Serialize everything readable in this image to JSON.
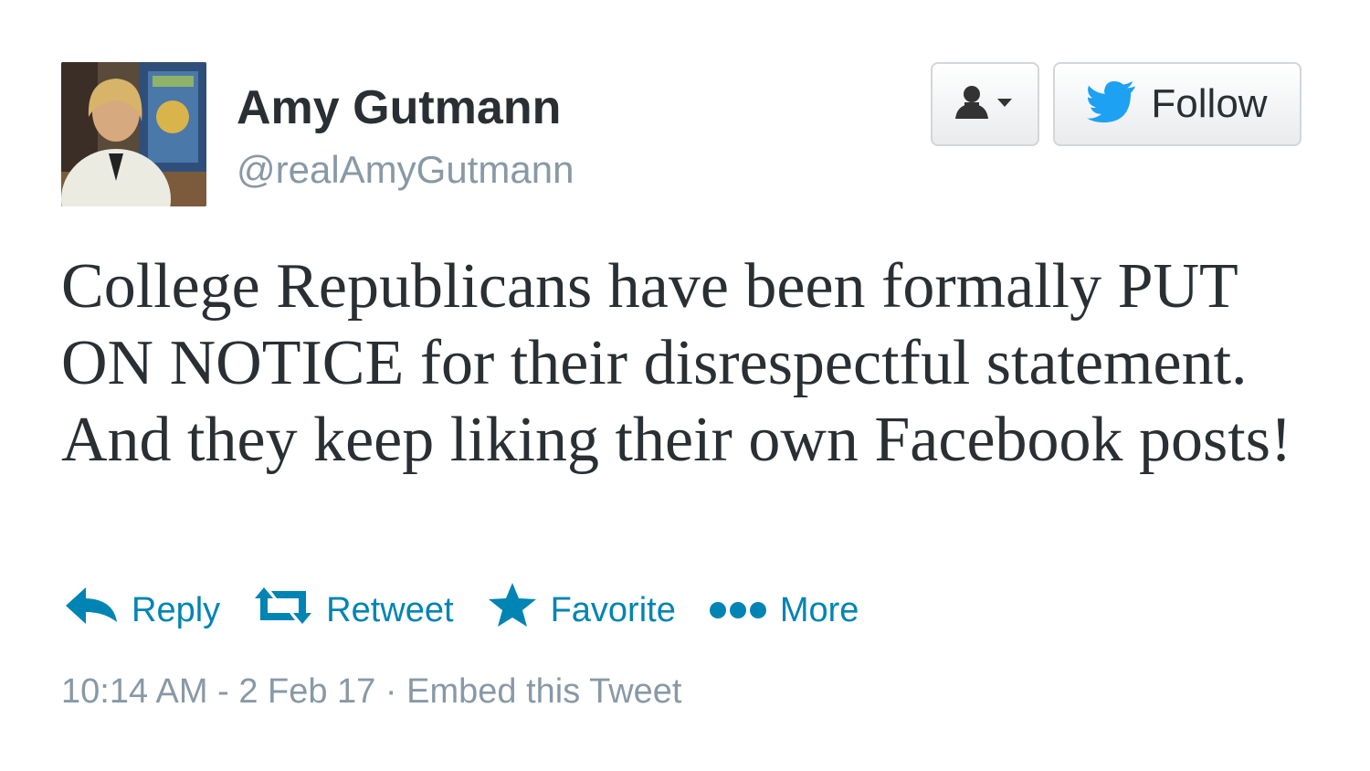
{
  "user": {
    "display_name": "Amy Gutmann",
    "handle": "@realAmyGutmann"
  },
  "buttons": {
    "user_dropdown_icon": "person-icon",
    "follow_label": "Follow"
  },
  "tweet": {
    "text": "College Republicans have been formally PUT ON NOTICE for their disrespectful statement. And they keep liking their own Facebook posts!"
  },
  "actions": {
    "reply": "Reply",
    "retweet": "Retweet",
    "favorite": "Favorite",
    "more": "More"
  },
  "meta": {
    "timestamp": "10:14 AM - 2 Feb 17",
    "separator": "·",
    "embed": "Embed this Tweet"
  },
  "colors": {
    "link": "#0084b4",
    "twitter_bird": "#1da1f2",
    "muted": "#8899a6",
    "text": "#292f33"
  }
}
